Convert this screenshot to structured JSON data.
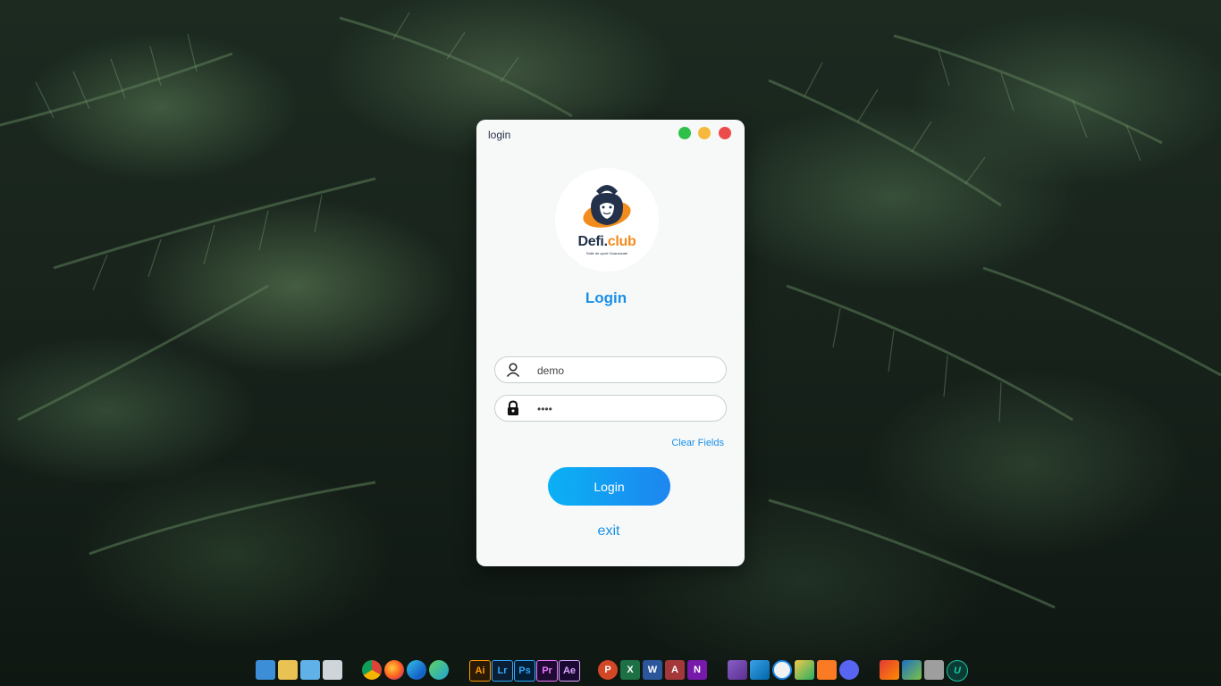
{
  "window": {
    "title": "login",
    "controls": {
      "maximize_color": "#2fc04a",
      "minimize_color": "#f6b93b",
      "close_color": "#ec4b4b"
    }
  },
  "logo": {
    "brand_dark": "Defi",
    "brand_dot": ".",
    "brand_light": "club",
    "tagline": "Salle de sport Ouarzazate",
    "colors": {
      "dark": "#23324a",
      "orange": "#f28c1d"
    }
  },
  "form": {
    "heading": "Login",
    "username": {
      "value": "demo",
      "icon": "user-icon"
    },
    "password": {
      "value": "demo",
      "icon": "lock-icon"
    },
    "clear_label": "Clear Fields",
    "login_label": "Login",
    "exit_label": "exit",
    "accent": "#1a8fe8"
  },
  "taskbar": {
    "groups": [
      [
        "this-pc-icon",
        "user-folder-icon",
        "control-panel-icon",
        "recycle-bin-icon"
      ],
      [
        "chrome-icon",
        "firefox-icon",
        "edge-icon",
        "edge-dev-icon"
      ],
      [
        "illustrator-icon",
        "lightroom-icon",
        "photoshop-icon",
        "premiere-icon",
        "after-effects-icon"
      ],
      [
        "powerpoint-icon",
        "excel-icon",
        "word-icon",
        "access-icon",
        "onenote-icon"
      ],
      [
        "visual-studio-icon",
        "vscode-icon",
        "app-w-icon",
        "app-x-icon",
        "xampp-icon",
        "discord-icon"
      ],
      [
        "ccleaner-icon",
        "virtualbox-icon",
        "server-icon",
        "upwork-icon"
      ]
    ],
    "labels": {
      "illustrator": "Ai",
      "lightroom": "Lr",
      "photoshop": "Ps",
      "premiere": "Pr",
      "after_effects": "Ae",
      "powerpoint": "P",
      "excel": "X",
      "word": "W",
      "access": "A",
      "onenote": "N",
      "upwork": "U"
    }
  }
}
